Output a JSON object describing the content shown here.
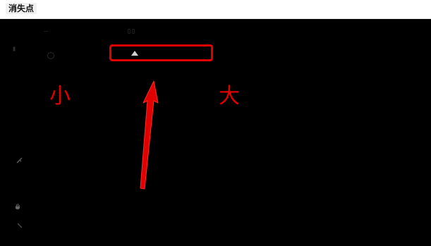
{
  "window": {
    "title": "消失点"
  },
  "labels": {
    "min": "小",
    "max": "大"
  },
  "dim_text": {
    "a": "—",
    "b": "▯▯",
    "c": "▮"
  },
  "icons": {
    "slider_thumb": "triangle-thumb-icon",
    "left_1": "pin-icon",
    "left_2": "hand-icon",
    "left_3": "pen-icon",
    "annotation": "red-arrow-icon"
  },
  "colors": {
    "highlight": "#e00000",
    "background": "#000000"
  }
}
